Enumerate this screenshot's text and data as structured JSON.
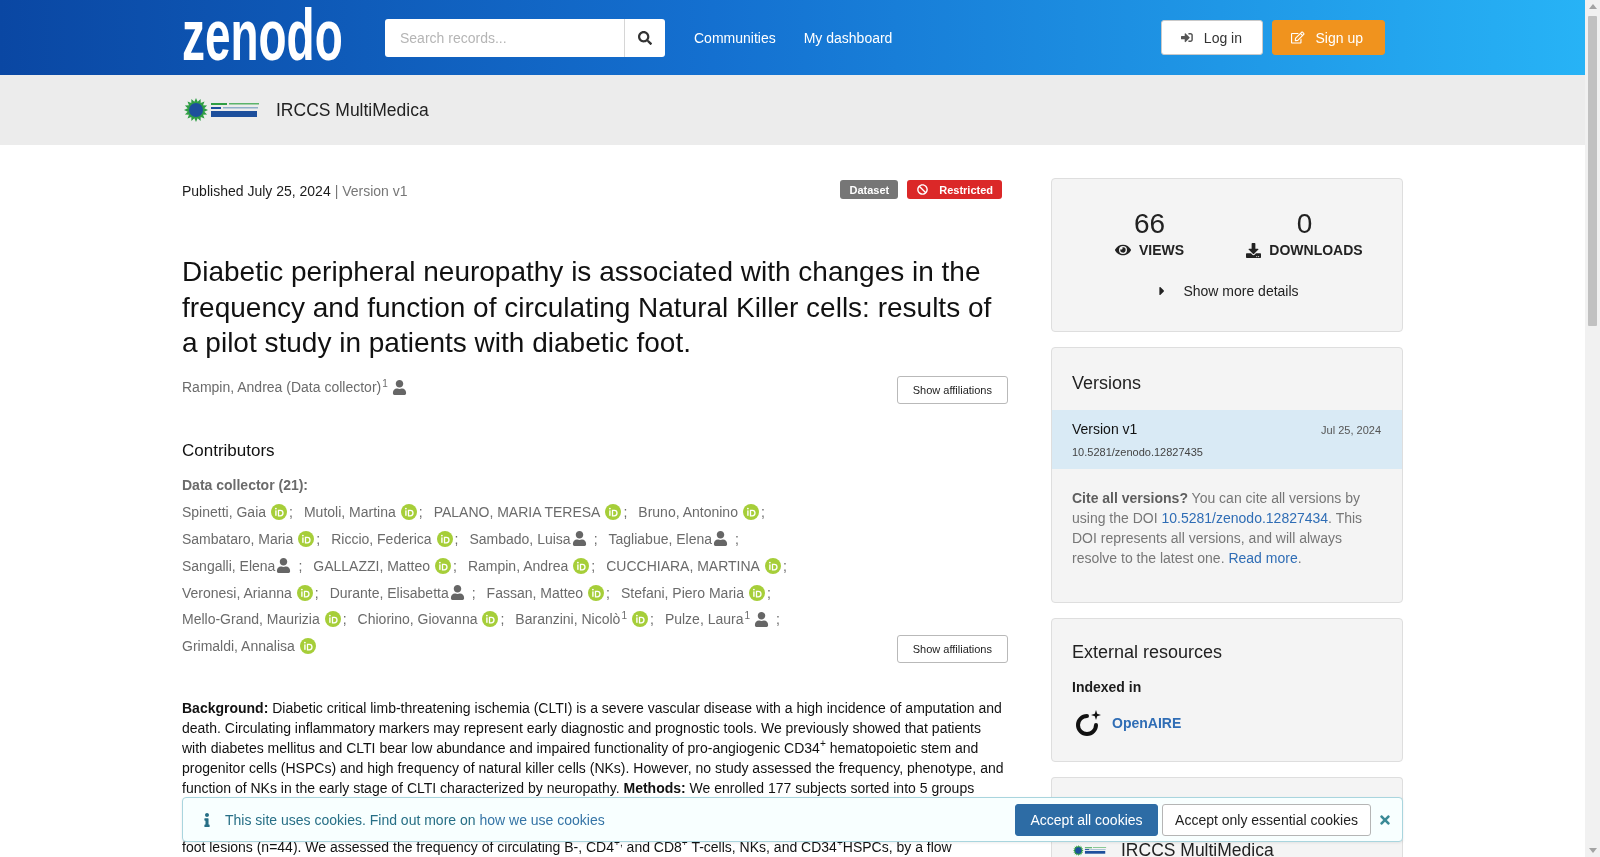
{
  "header": {
    "logo": "zenodo",
    "search": {
      "placeholder": "Search records..."
    },
    "nav": [
      "Communities",
      "My dashboard"
    ],
    "actions": [
      {
        "kind": "login",
        "label": "Log in"
      },
      {
        "kind": "signup",
        "label": "Sign up"
      }
    ]
  },
  "community_bar": {
    "name": "IRCCS MultiMedica"
  },
  "record": {
    "published": "Published July 25, 2024",
    "version": "| Version v1",
    "badges": [
      {
        "kind": "resource_type",
        "label": "Dataset"
      },
      {
        "kind": "access",
        "label": "Restricted"
      }
    ],
    "title": "Diabetic peripheral neuropathy is associated with changes in the frequency and function of circulating Natural Killer cells: results of a pilot study in patients with diabetic foot.",
    "creators": [
      {
        "name": "Rampin, Andrea (Data collector)",
        "affiliation_mark": "1",
        "kind": "person"
      }
    ],
    "creators_button": "Show affiliations",
    "contributors": {
      "heading": "Contributors",
      "role": "Data collector (21):",
      "people": [
        {
          "name": "Spinetti, Gaia",
          "kind": "orcid",
          "separator": ";"
        },
        {
          "name": "Mutoli, Martina",
          "kind": "orcid",
          "separator": ";"
        },
        {
          "name": "PALANO, MARIA TERESA",
          "kind": "orcid",
          "separator": ";"
        },
        {
          "name": "Bruno, Antonino",
          "kind": "orcid",
          "separator": ";"
        },
        {
          "name": "Sambataro, Maria",
          "kind": "orcid",
          "separator": ";"
        },
        {
          "name": "Riccio, Federica",
          "kind": "orcid",
          "separator": ";"
        },
        {
          "name": "Sambado, Luisa",
          "kind": "person",
          "separator": ";"
        },
        {
          "name": "Tagliabue, Elena",
          "kind": "person",
          "separator": ";"
        },
        {
          "name": "Sangalli, Elena",
          "kind": "person",
          "separator": ";"
        },
        {
          "name": "GALLAZZI, Matteo",
          "kind": "orcid",
          "separator": ";"
        },
        {
          "name": "Rampin, Andrea",
          "kind": "orcid",
          "separator": ";"
        },
        {
          "name": "CUCCHIARA, MARTINA",
          "kind": "orcid",
          "separator": ";"
        },
        {
          "name": "Veronesi, Arianna",
          "kind": "orcid",
          "separator": ";"
        },
        {
          "name": "Durante, Elisabetta",
          "kind": "person",
          "separator": ";"
        },
        {
          "name": "Fassan, Matteo",
          "kind": "orcid",
          "separator": ";"
        },
        {
          "name": "Stefani, Piero Maria",
          "kind": "orcid",
          "separator": ";"
        },
        {
          "name": "Mello-Grand, Maurizia",
          "kind": "orcid",
          "separator": ";"
        },
        {
          "name": "Chiorino, Giovanna",
          "kind": "orcid",
          "separator": ";"
        },
        {
          "name": "Baranzini, Nicolò",
          "affiliation_mark": "1",
          "kind": "orcid",
          "separator": ";"
        },
        {
          "name": "Pulze, Laura",
          "affiliation_mark": "1",
          "kind": "person",
          "separator": ";"
        },
        {
          "name": "Grimaldi, Annalisa",
          "kind": "orcid"
        }
      ],
      "button": "Show affiliations"
    },
    "description": [
      "**Background:** Diabetic critical limb-threatening ischemia (CLTI) is a severe vascular disease with a high incidence of amputation and death. Circulating inflammatory markers may represent early diagnostic and prognostic tools. We previously showed that patients with diabetes mellitus and CLTI bear low abundance and impaired functionality of pro-angiogenic CD34$^{+}$ hematopoietic stem and progenitor cells (HSPCs) and high frequency of natural killer cells (NKs). However, no study assessed the frequency, phenotype, and function of NKs in the early stage of CLTI characterized by neuropathy. **Methods:** We enrolled 177 subjects sorted into 5 groups",
      "foot lesions (n=44). We assessed the frequency of circulating B-, CD4$^{+,}$ and CD8$^{+}$ T-cells, NKs, and CD34$^{+}$HSPCs, by a flow"
    ]
  },
  "sidebar": {
    "stats": [
      {
        "kind": "views",
        "value": "66",
        "label": "VIEWS"
      },
      {
        "kind": "downloads",
        "value": "0",
        "label": "DOWNLOADS"
      }
    ],
    "details_toggle": {
      "label": "Show more details",
      "expanded": false
    },
    "versions": {
      "heading": "Versions",
      "items": [
        {
          "label": "Version v1",
          "date": "Jul 25, 2024",
          "doi": "10.5281/zenodo.12827435",
          "selected": true
        }
      ],
      "note": [
        {
          "kind": "text",
          "text": "**Cite all versions?** You can cite all versions by using the DOI "
        },
        {
          "kind": "link",
          "text": "10.5281/zenodo.12827434"
        },
        {
          "kind": "text",
          "text": ". This DOI represents all versions, and will always resolve to the latest one. "
        },
        {
          "kind": "link",
          "text": "Read more"
        },
        {
          "kind": "text",
          "text": "."
        }
      ]
    },
    "external_resources": {
      "heading": "External resources",
      "subheading": "Indexed in",
      "links": [
        {
          "label": "OpenAIRE"
        }
      ]
    },
    "communities": [
      {
        "name": "IRCCS MultiMedica"
      }
    ]
  },
  "cookie_banner": {
    "message": "This site uses cookies. Find out more on",
    "link": "how we use cookies",
    "buttons": [
      {
        "kind": "primary",
        "label": "Accept all cookies"
      },
      {
        "kind": "secondary",
        "label": "Accept only essential cookies"
      }
    ]
  }
}
